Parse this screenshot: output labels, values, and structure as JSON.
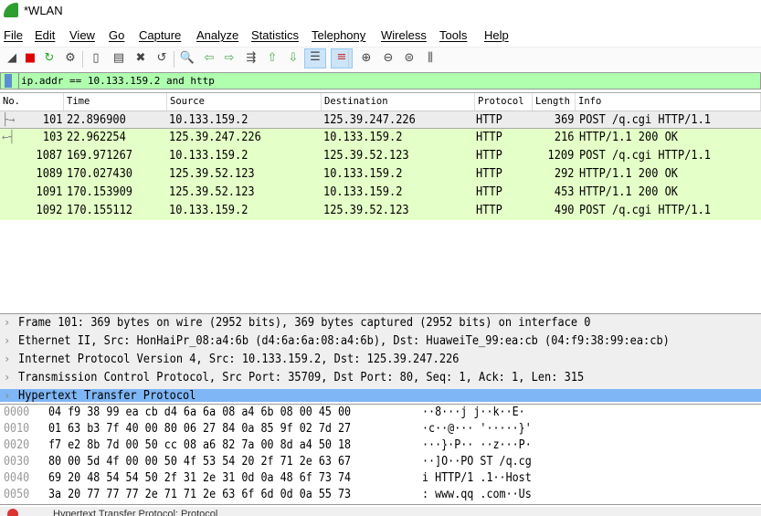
{
  "window": {
    "title": "*WLAN"
  },
  "menu": [
    "File",
    "Edit",
    "View",
    "Go",
    "Capture",
    "Analyze",
    "Statistics",
    "Telephony",
    "Wireless",
    "Tools",
    "Help"
  ],
  "toolbar": [
    {
      "icon": "shark-fin-start-icon"
    },
    {
      "icon": "stop-capture-icon"
    },
    {
      "icon": "restart-capture-icon"
    },
    {
      "icon": "capture-options-icon"
    },
    {
      "icon": "open-file-icon"
    },
    {
      "icon": "save-file-icon"
    },
    {
      "icon": "close-file-icon"
    },
    {
      "icon": "reload-file-icon"
    },
    {
      "icon": "find-packet-icon"
    },
    {
      "icon": "go-back-icon"
    },
    {
      "icon": "go-forward-icon"
    },
    {
      "icon": "go-to-packet-icon"
    },
    {
      "icon": "go-first-icon"
    },
    {
      "icon": "go-last-icon"
    },
    {
      "icon": "autoscroll-icon",
      "active": true
    },
    {
      "icon": "colorize-icon",
      "active": true
    },
    {
      "icon": "zoom-in-icon"
    },
    {
      "icon": "zoom-out-icon"
    },
    {
      "icon": "zoom-normal-icon"
    },
    {
      "icon": "resize-columns-icon"
    }
  ],
  "filter": {
    "value": "ip.addr == 10.133.159.2 and http"
  },
  "packet_list": {
    "columns": [
      "No.",
      "Time",
      "Source",
      "Destination",
      "Protocol",
      "Length",
      "Info"
    ],
    "rows": [
      {
        "no": "101",
        "time": "22.896900",
        "src": "10.133.159.2",
        "dst": "125.39.247.226",
        "proto": "HTTP",
        "len": "369",
        "info": "POST /q.cgi HTTP/1.1",
        "selected": true
      },
      {
        "no": "103",
        "time": "22.962254",
        "src": "125.39.247.226",
        "dst": "10.133.159.2",
        "proto": "HTTP",
        "len": "216",
        "info": "HTTP/1.1 200 OK"
      },
      {
        "no": "1087",
        "time": "169.971267",
        "src": "10.133.159.2",
        "dst": "125.39.52.123",
        "proto": "HTTP",
        "len": "1209",
        "info": "POST /q.cgi HTTP/1.1"
      },
      {
        "no": "1089",
        "time": "170.027430",
        "src": "125.39.52.123",
        "dst": "10.133.159.2",
        "proto": "HTTP",
        "len": "292",
        "info": "HTTP/1.1 200 OK"
      },
      {
        "no": "1091",
        "time": "170.153909",
        "src": "125.39.52.123",
        "dst": "10.133.159.2",
        "proto": "HTTP",
        "len": "453",
        "info": "HTTP/1.1 200 OK"
      },
      {
        "no": "1092",
        "time": "170.155112",
        "src": "10.133.159.2",
        "dst": "125.39.52.123",
        "proto": "HTTP",
        "len": "490",
        "info": "POST /q.cgi HTTP/1.1"
      }
    ]
  },
  "details": [
    "Frame 101: 369 bytes on wire (2952 bits), 369 bytes captured (2952 bits) on interface 0",
    "Ethernet II, Src: HonHaiPr_08:a4:6b (d4:6a:6a:08:a4:6b), Dst: HuaweiTe_99:ea:cb (04:f9:38:99:ea:cb)",
    "Internet Protocol Version 4, Src: 10.133.159.2, Dst: 125.39.247.226",
    "Transmission Control Protocol, Src Port: 35709, Dst Port: 80, Seq: 1, Ack: 1, Len: 315",
    "Hypertext Transfer Protocol"
  ],
  "bytes": [
    {
      "offset": "0000",
      "hex": "04 f9 38 99 ea cb d4 6a  6a 08 a4 6b 08 00 45 00",
      "ascii": "··8···j j··k··E·"
    },
    {
      "offset": "0010",
      "hex": "01 63 b3 7f 40 00 80 06  27 84 0a 85 9f 02 7d 27",
      "ascii": "·c··@··· '·····}'"
    },
    {
      "offset": "0020",
      "hex": "f7 e2 8b 7d 00 50 cc 08  a6 82 7a 00 8d a4 50 18",
      "ascii": "···}·P·· ··z···P·"
    },
    {
      "offset": "0030",
      "hex": "80 00 5d 4f 00 00 50 4f  53 54 20 2f 71 2e 63 67",
      "ascii": "··]O··PO ST /q.cg"
    },
    {
      "offset": "0040",
      "hex": "69 20 48 54 54 50 2f 31  2e 31 0d 0a 48 6f 73 74",
      "ascii": "i HTTP/1 .1··Host"
    },
    {
      "offset": "0050",
      "hex": "3a 20 77 77 77 2e 71 71  2e 63 6f 6d 0d 0a 55 73",
      "ascii": ": www.qq .com··Us"
    }
  ],
  "status": {
    "text": "Hypertext Transfer Protocol: Protocol"
  },
  "colors": {
    "http_row": "#e4ffc7",
    "selected_row": "#ececec",
    "filter_bg": "#afffaf",
    "selected_detail": "#7fb6f5"
  }
}
